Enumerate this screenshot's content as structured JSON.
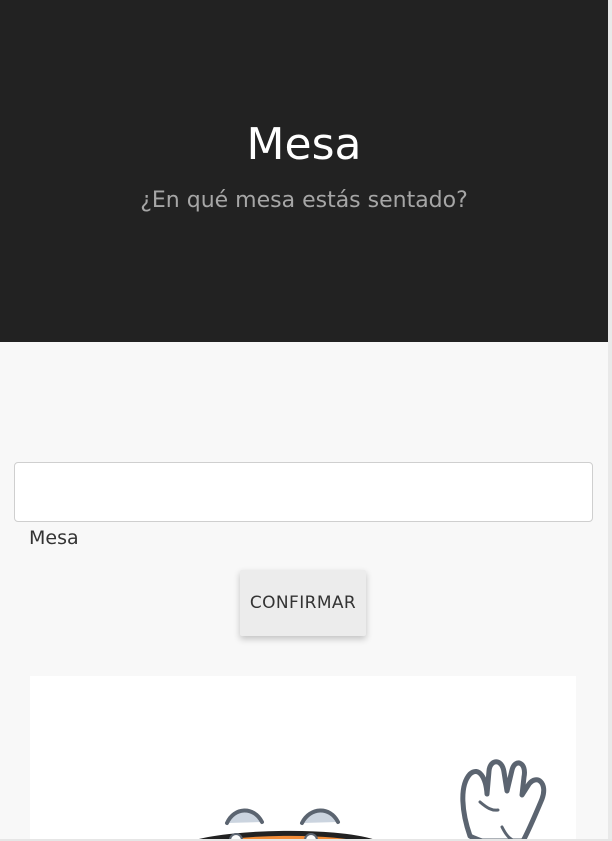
{
  "hero": {
    "title": "Mesa",
    "subtitle": "¿En qué mesa estás sentado?"
  },
  "form": {
    "input_value": "",
    "label": "Mesa",
    "confirm_label": "CONFIRMAR"
  },
  "illustration": {
    "icon": "waving-mascot"
  },
  "colors": {
    "hero_background": "#222222",
    "hero_title": "#ffffff",
    "hero_subtitle": "#a6a6a6",
    "page_background": "#f8f8f8",
    "button_background": "#ececec",
    "mascot_orange": "#f28c38",
    "mascot_outline": "#5b6470"
  }
}
